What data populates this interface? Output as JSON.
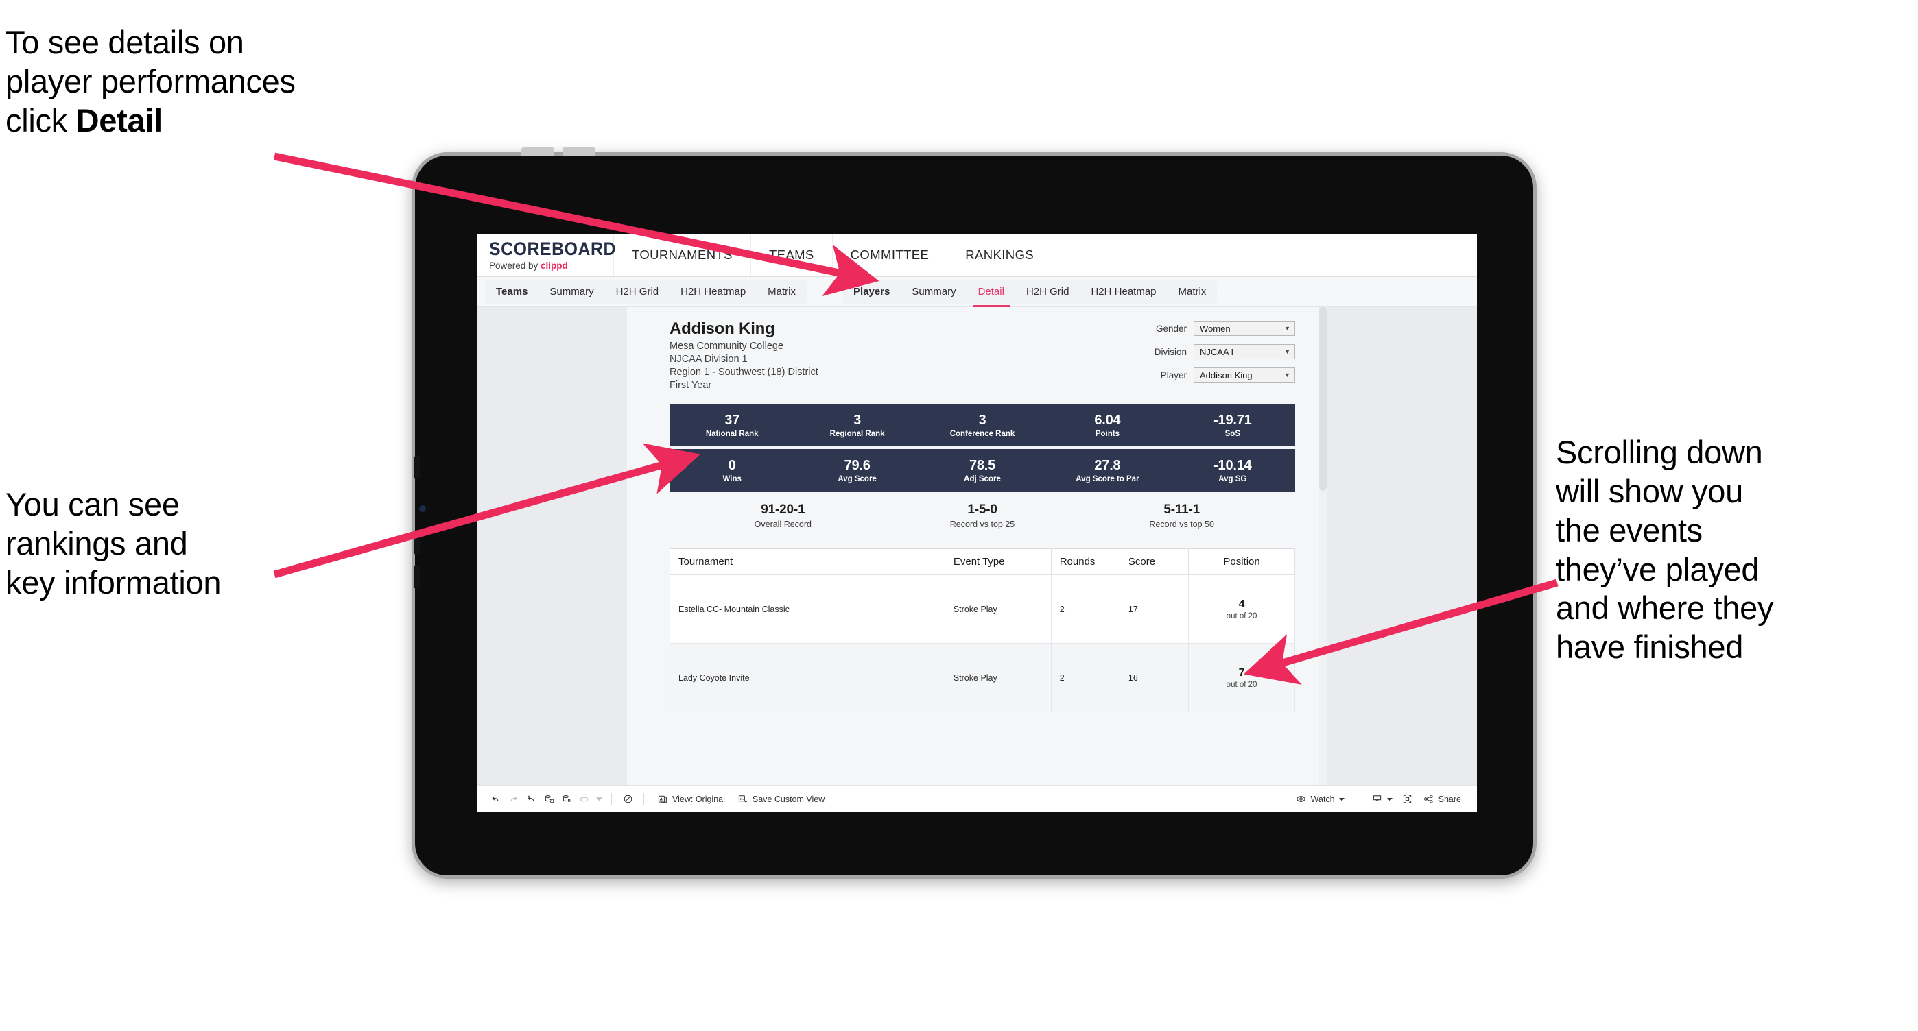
{
  "annotations": {
    "top_left_line1": "To see details on",
    "top_left_line2": "player performances",
    "top_left_line3_prefix": "click ",
    "top_left_line3_bold": "Detail",
    "mid_left_line1": "You can see",
    "mid_left_line2": "rankings and",
    "mid_left_line3": "key information",
    "right_line1": "Scrolling down",
    "right_line2": "will show you",
    "right_line3": "the events",
    "right_line4": "they’ve played",
    "right_line5": "and where they",
    "right_line6": "have finished",
    "arrow_color": "#ec2a5b"
  },
  "app": {
    "logo_main": "SCOREBOARD",
    "logo_sub_prefix": "Powered by ",
    "logo_sub_brand": "clippd",
    "topnav": [
      "TOURNAMENTS",
      "TEAMS",
      "COMMITTEE",
      "RANKINGS"
    ],
    "subnav_group1": [
      "Teams",
      "Summary",
      "H2H Grid",
      "H2H Heatmap",
      "Matrix"
    ],
    "subnav_group2": [
      "Players",
      "Summary",
      "Detail",
      "H2H Grid",
      "H2H Heatmap",
      "Matrix"
    ],
    "subnav_active": "Detail",
    "accent_color": "#e8376a",
    "navy_color": "#2f3750"
  },
  "player": {
    "name": "Addison King",
    "school": "Mesa Community College",
    "division": "NJCAA Division 1",
    "region": "Region 1 - Southwest (18) District",
    "year": "First Year"
  },
  "filters": [
    {
      "label": "Gender",
      "value": "Women"
    },
    {
      "label": "Division",
      "value": "NJCAA I"
    },
    {
      "label": "Player",
      "value": "Addison King"
    }
  ],
  "stats_row1": [
    {
      "value": "37",
      "label": "National Rank"
    },
    {
      "value": "3",
      "label": "Regional Rank"
    },
    {
      "value": "3",
      "label": "Conference Rank"
    },
    {
      "value": "6.04",
      "label": "Points"
    },
    {
      "value": "-19.71",
      "label": "SoS"
    }
  ],
  "stats_row2": [
    {
      "value": "0",
      "label": "Wins"
    },
    {
      "value": "79.6",
      "label": "Avg Score"
    },
    {
      "value": "78.5",
      "label": "Adj Score"
    },
    {
      "value": "27.8",
      "label": "Avg Score to Par"
    },
    {
      "value": "-10.14",
      "label": "Avg SG"
    }
  ],
  "records": [
    {
      "value": "91-20-1",
      "label": "Overall Record"
    },
    {
      "value": "1-5-0",
      "label": "Record vs top 25"
    },
    {
      "value": "5-11-1",
      "label": "Record vs top 50"
    }
  ],
  "table": {
    "headers": [
      "Tournament",
      "Event Type",
      "Rounds",
      "Score",
      "Position"
    ],
    "rows": [
      {
        "tournament": "Estella CC- Mountain Classic",
        "event_type": "Stroke Play",
        "rounds": "2",
        "score": "17",
        "position": "4",
        "position_sub": "out of 20"
      },
      {
        "tournament": "Lady Coyote Invite",
        "event_type": "Stroke Play",
        "rounds": "2",
        "score": "16",
        "position": "7",
        "position_sub": "out of 20"
      }
    ]
  },
  "toolbar": {
    "view_label": "View: Original",
    "save_label": "Save Custom View",
    "watch_label": "Watch",
    "share_label": "Share",
    "icons": [
      "undo-icon",
      "redo-icon",
      "revert-icon",
      "refresh-icon",
      "pause-icon",
      "pill-icon",
      "dropdown-caret-icon",
      "dashboard-icon"
    ]
  }
}
